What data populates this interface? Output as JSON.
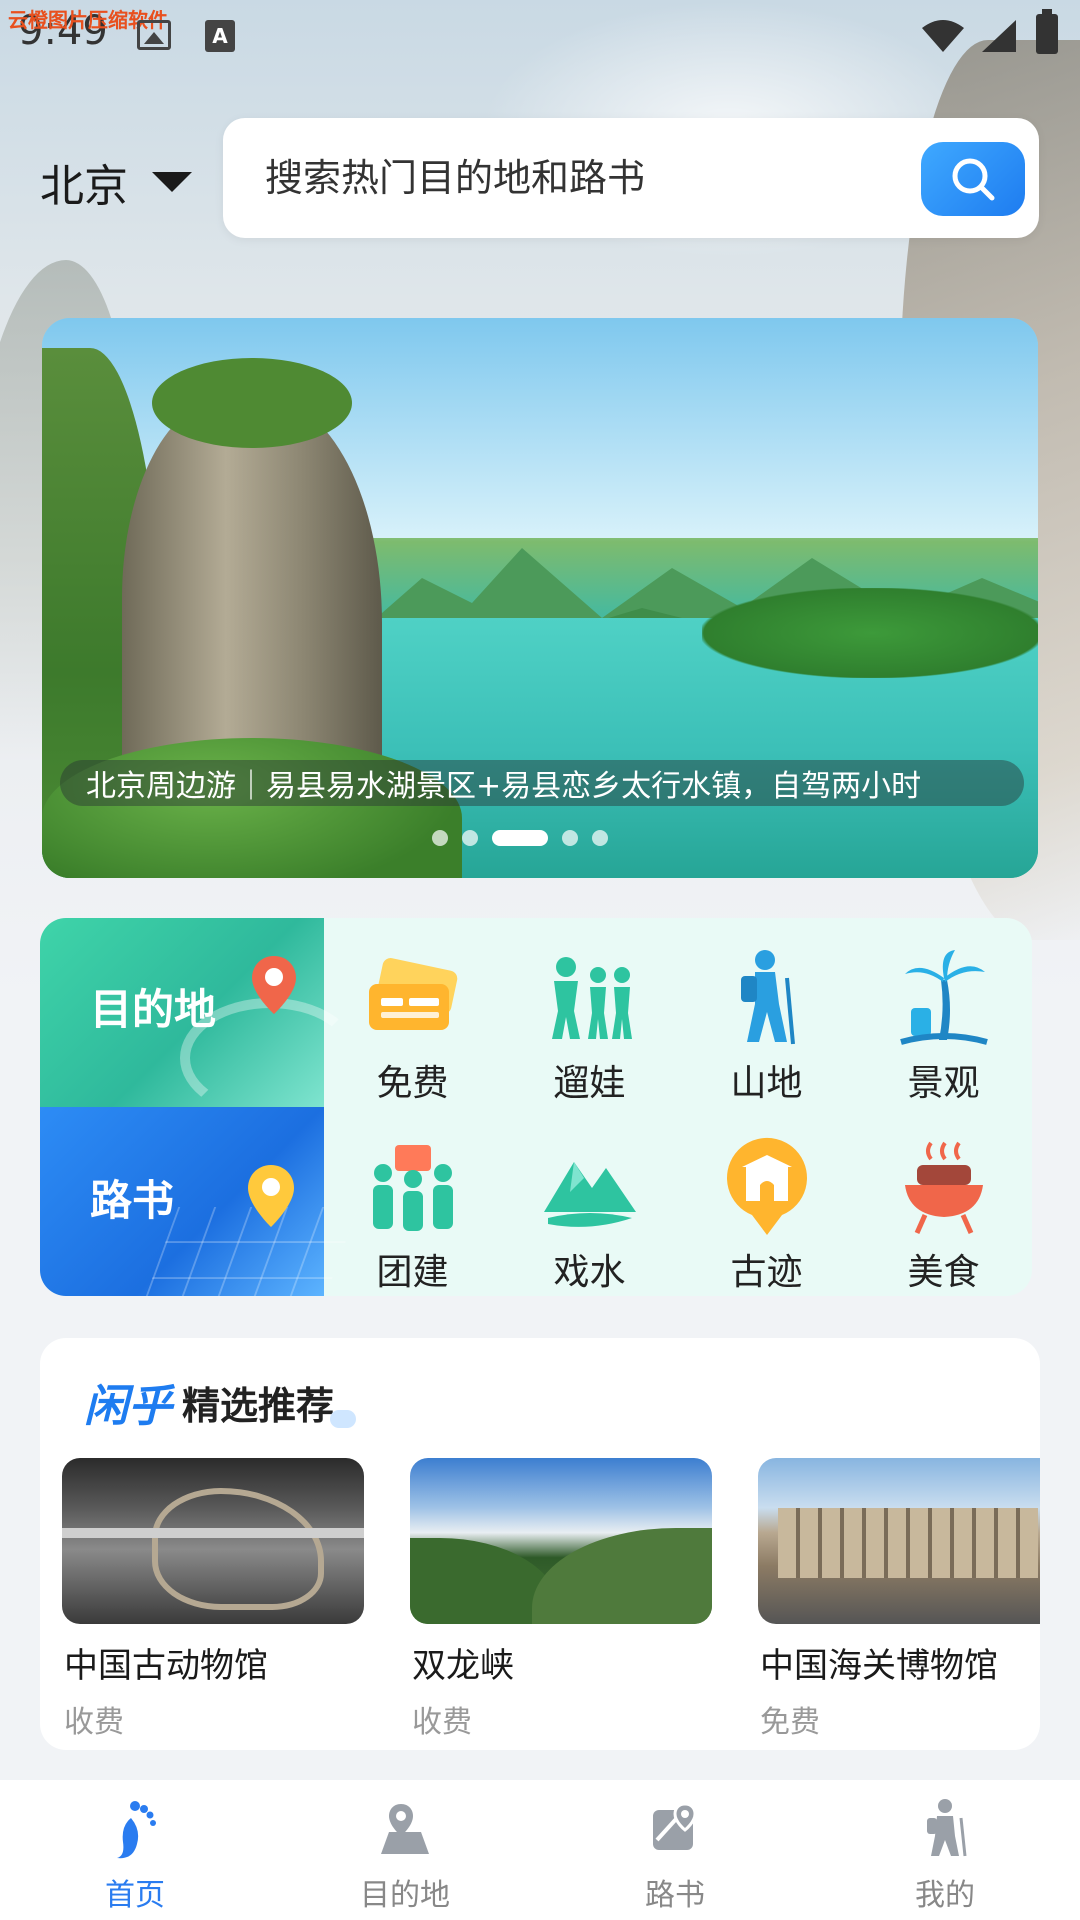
{
  "status_bar": {
    "time": "9:49",
    "watermark": "云橙图片压缩软件"
  },
  "header": {
    "city": "北京",
    "search_placeholder": "搜索热门目的地和路书"
  },
  "banner": {
    "caption": "北京周边游｜易县易水湖景区+易县恋乡太行水镇，自驾两小时",
    "active_slide": 3,
    "total_slides": 5
  },
  "category": {
    "tiles": [
      {
        "label": "目的地",
        "icon": "map-pin-icon"
      },
      {
        "label": "路书",
        "icon": "location-pin-icon"
      }
    ],
    "items": [
      {
        "label": "免费",
        "icon": "ticket-icon"
      },
      {
        "label": "遛娃",
        "icon": "family-icon"
      },
      {
        "label": "山地",
        "icon": "hiker-icon"
      },
      {
        "label": "景观",
        "icon": "palm-tree-icon"
      },
      {
        "label": "团建",
        "icon": "team-icon"
      },
      {
        "label": "戏水",
        "icon": "mountain-river-icon"
      },
      {
        "label": "古迹",
        "icon": "ancient-gate-icon"
      },
      {
        "label": "美食",
        "icon": "bbq-grill-icon"
      }
    ],
    "colors": {
      "dest_tile": "#2fb99c",
      "road_tile": "#1c6fe0",
      "icon_accent": "#2ec4a0",
      "icon_orange": "#ffb52e"
    }
  },
  "recommend": {
    "brand": "闲乎",
    "title": "精选推荐",
    "items": [
      {
        "name": "中国古动物馆",
        "price": "收费"
      },
      {
        "name": "双龙峡",
        "price": "收费"
      },
      {
        "name": "中国海关博物馆",
        "price": "免费"
      }
    ]
  },
  "tabbar": {
    "items": [
      {
        "label": "首页",
        "icon": "footprint-icon",
        "active": true
      },
      {
        "label": "目的地",
        "icon": "map-location-icon",
        "active": false
      },
      {
        "label": "路书",
        "icon": "route-map-icon",
        "active": false
      },
      {
        "label": "我的",
        "icon": "hiker-profile-icon",
        "active": false
      }
    ],
    "active_color": "#2a7cf0"
  }
}
